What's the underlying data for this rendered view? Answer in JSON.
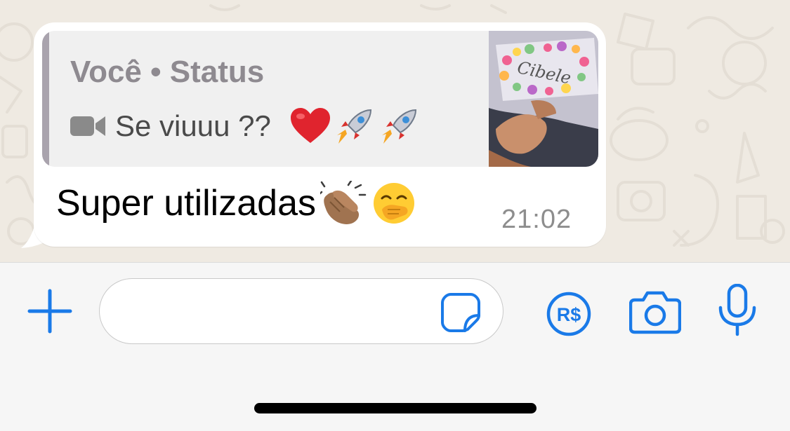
{
  "message": {
    "quote": {
      "author": "Você • Status",
      "caption": "Se viuuu ??",
      "emojis": [
        "heart",
        "rocket",
        "rocket"
      ],
      "media_type": "video",
      "thumbnail_text": "Cibele"
    },
    "text": "Super utilizadas",
    "trailing_emojis": [
      "clapping-hands",
      "hand-over-mouth"
    ],
    "time": "21:02"
  },
  "composer": {
    "input_value": "",
    "icons": [
      "plus-icon",
      "sticker-icon",
      "payment-icon",
      "camera-icon",
      "microphone-icon"
    ],
    "payment_label": "R$"
  },
  "colors": {
    "accent": "#1a7ae8",
    "wallpaper": "#efeae2",
    "bubble": "#ffffff",
    "quote_bg": "#f0f0f0",
    "quote_bar": "#a9a3ad",
    "heart": "#e0242e"
  }
}
